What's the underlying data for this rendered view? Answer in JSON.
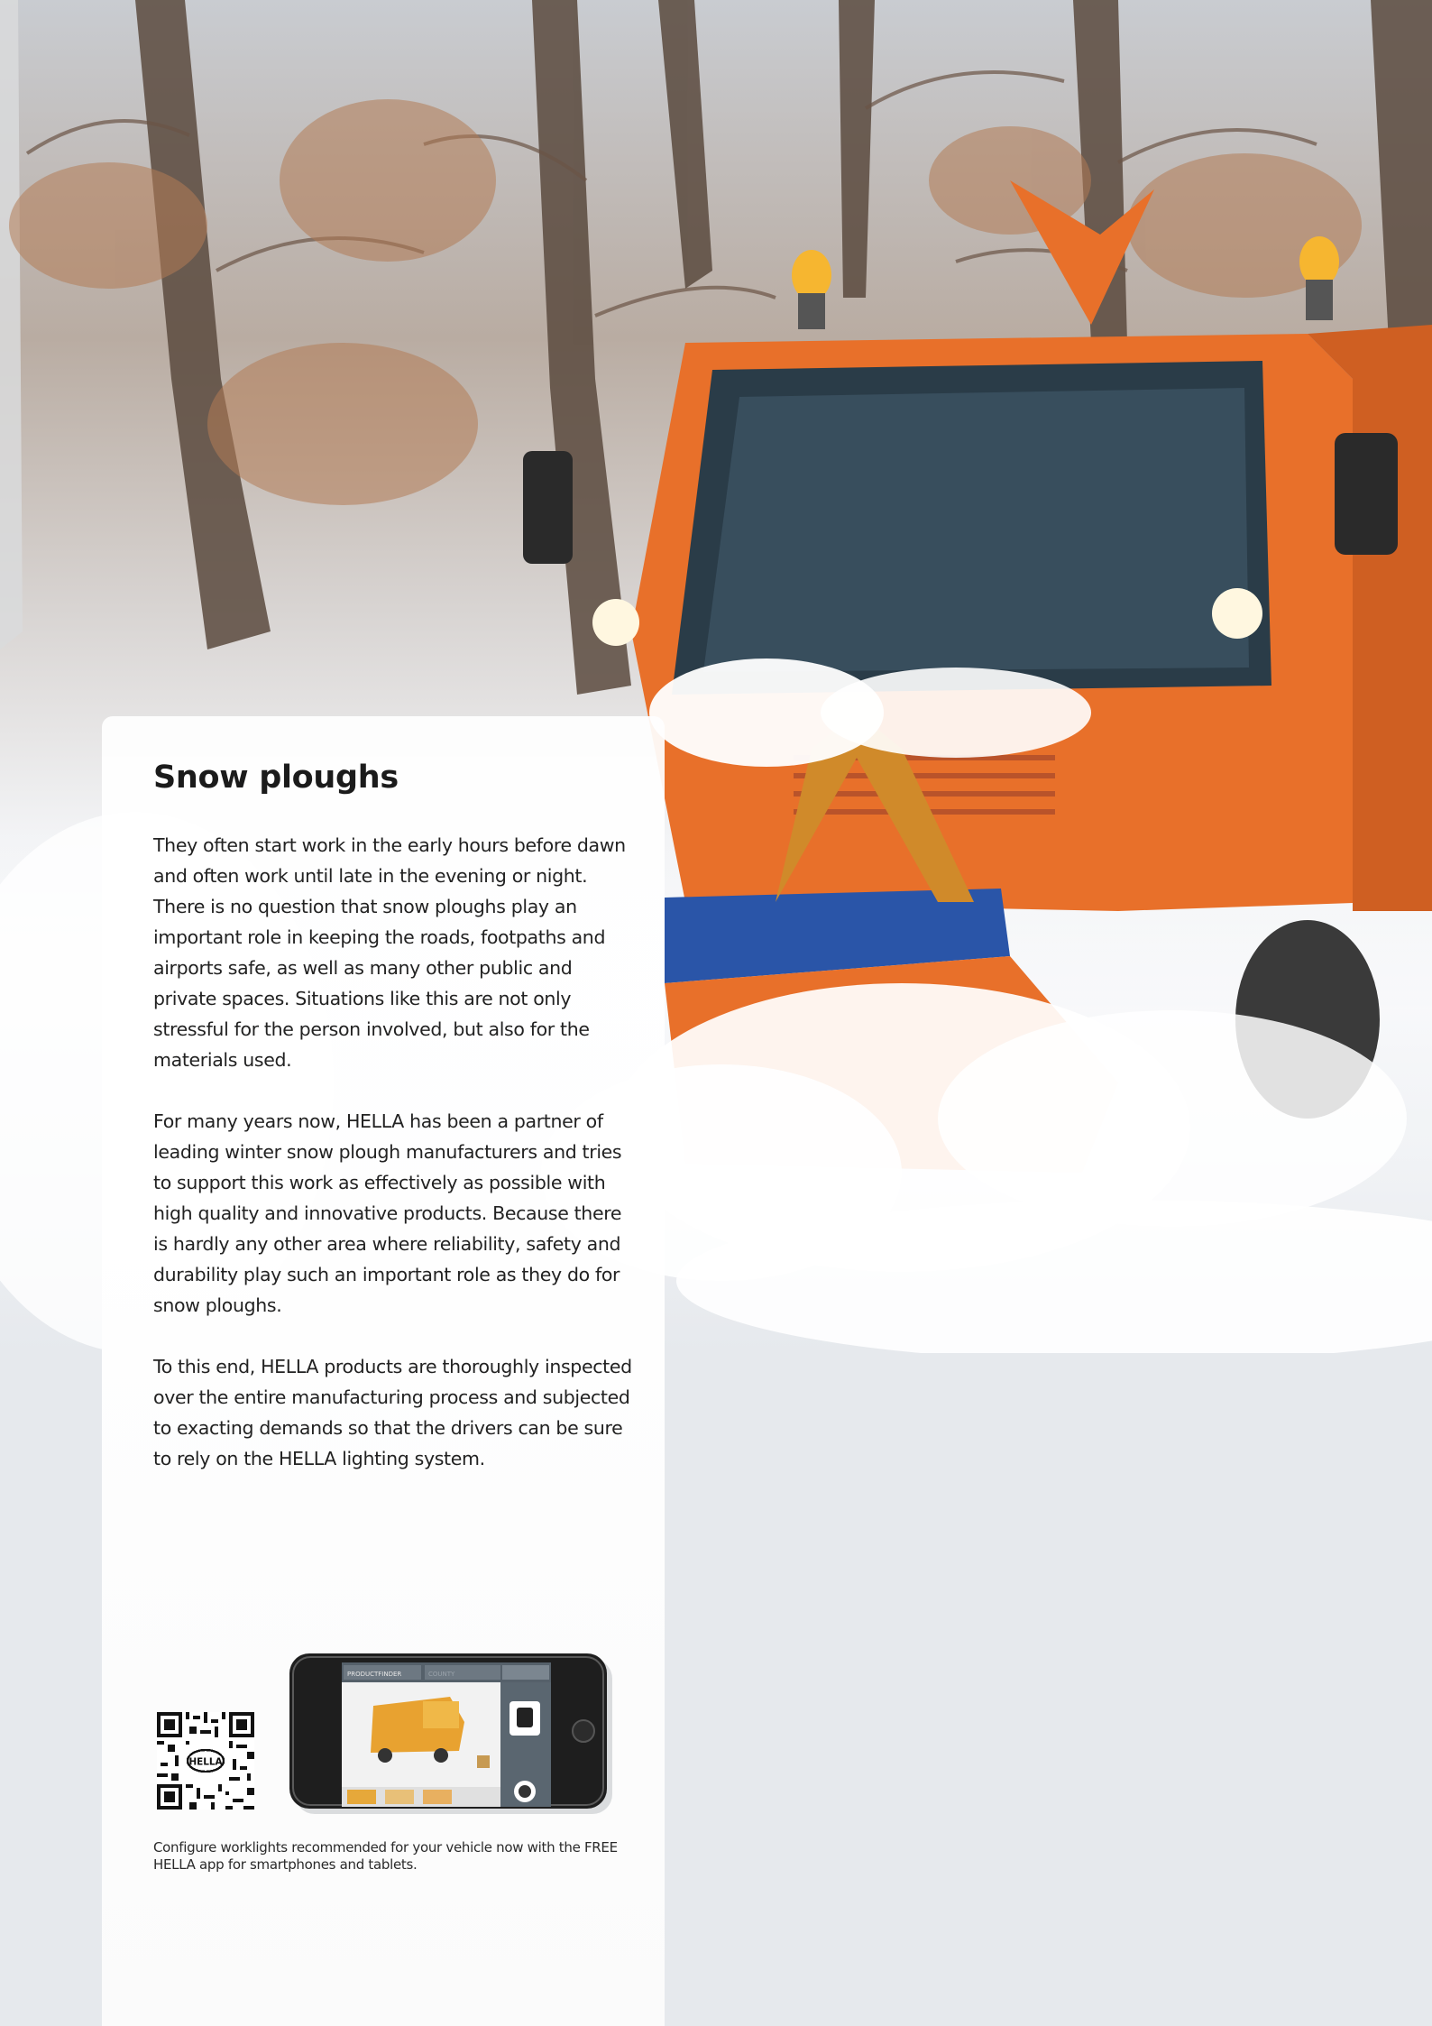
{
  "article": {
    "title": "Snow ploughs",
    "paragraphs": [
      "They often start work in the early hours before dawn and often work until late in the evening or night. There is no question that snow ploughs play an important role in keeping the roads, footpaths and airports safe, as well as many other public and private spaces. Situations like this are not only stressful for the person involved, but also for the materials used.",
      "For many years now, HELLA has been a partner of leading winter snow plough manufacturers and tries to support this work as effectively as possible with high quality and innovative products. Because there is hardly any other area where reliability, safety and durability play such an important role as they do for snow ploughs.",
      "To this end, HELLA products are thoroughly inspected over the entire manufacturing process and subjected to exacting demands so that the drivers can be sure to rely on the HELLA lighting system."
    ]
  },
  "promo": {
    "caption": "Configure worklights recommended for your vehicle now with the FREE HELLA app for smartphones and tablets.",
    "qr_logo_text": "HELLA",
    "app_screen": {
      "dropdown_1": "PRODUCTFINDER",
      "dropdown_2": "COUNTY"
    }
  },
  "colors": {
    "truck_orange": "#e8702a",
    "plough_blue": "#2a55a8",
    "panel_bg": "#ffffff",
    "page_bg": "#e6e9ed"
  }
}
